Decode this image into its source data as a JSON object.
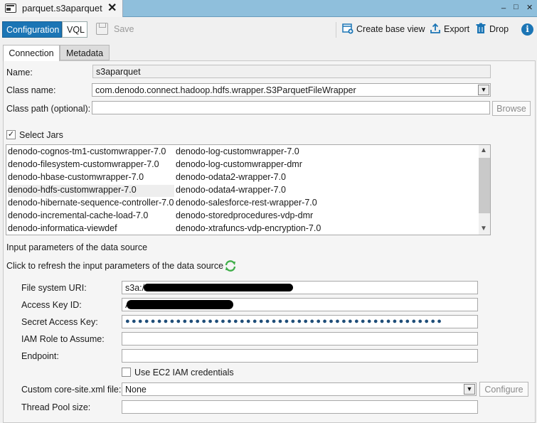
{
  "tab": {
    "title": "parquet.s3aparquet",
    "close_glyph": "✕"
  },
  "window_controls": {
    "minimize": "_",
    "maximize": "□",
    "close": "✕"
  },
  "toolbar": {
    "configuration": "Configuration",
    "vql": "VQL",
    "save": "Save",
    "create_base_view": "Create base view",
    "export": "Export",
    "drop": "Drop",
    "info": "i"
  },
  "inner_tabs": {
    "connection": "Connection",
    "metadata": "Metadata"
  },
  "form": {
    "name_label": "Name:",
    "name_value": "s3aparquet",
    "class_name_label": "Class name:",
    "class_name_value": "com.denodo.connect.hadoop.hdfs.wrapper.S3ParquetFileWrapper",
    "class_path_label": "Class path (optional):",
    "class_path_value": "",
    "browse": "Browse",
    "select_jars_label": "Select Jars",
    "select_jars_checked": true
  },
  "jars": {
    "left": [
      "denodo-cognos-tm1-customwrapper-7.0",
      "denodo-filesystem-customwrapper-7.0",
      "denodo-hbase-customwrapper-7.0",
      "denodo-hdfs-customwrapper-7.0",
      "denodo-hibernate-sequence-controller-7.0",
      "denodo-incremental-cache-load-7.0",
      "denodo-informatica-viewdef"
    ],
    "right": [
      "denodo-log-customwrapper-7.0",
      "denodo-log-customwrapper-dmr",
      "denodo-odata2-wrapper-7.0",
      "denodo-odata4-wrapper-7.0",
      "denodo-salesforce-rest-wrapper-7.0",
      "denodo-storedprocedures-vdp-dmr",
      "denodo-xtrafuncs-vdp-encryption-7.0"
    ],
    "selected": "denodo-hdfs-customwrapper-7.0"
  },
  "params": {
    "heading": "Input parameters of the data source",
    "refresh_text": "Click to refresh the input parameters of the data source",
    "fs_uri_label": "File system URI:",
    "fs_uri_value": "s3a://",
    "access_key_label": "Access Key ID:",
    "access_key_value": "A",
    "secret_key_label": "Secret Access Key:",
    "secret_key_value": "●●●●●●●●●●●●●●●●●●●●●●●●●●●●●●●●●●●●●●●●●●●●●●●●●●",
    "iam_role_label": "IAM Role to Assume:",
    "iam_role_value": "",
    "endpoint_label": "Endpoint:",
    "endpoint_value": "",
    "ec2_label": "Use EC2 IAM credentials",
    "ec2_checked": false,
    "core_site_label": "Custom core-site.xml file:",
    "core_site_value": "None",
    "configure": "Configure",
    "thread_pool_label": "Thread Pool size:",
    "thread_pool_value": ""
  }
}
